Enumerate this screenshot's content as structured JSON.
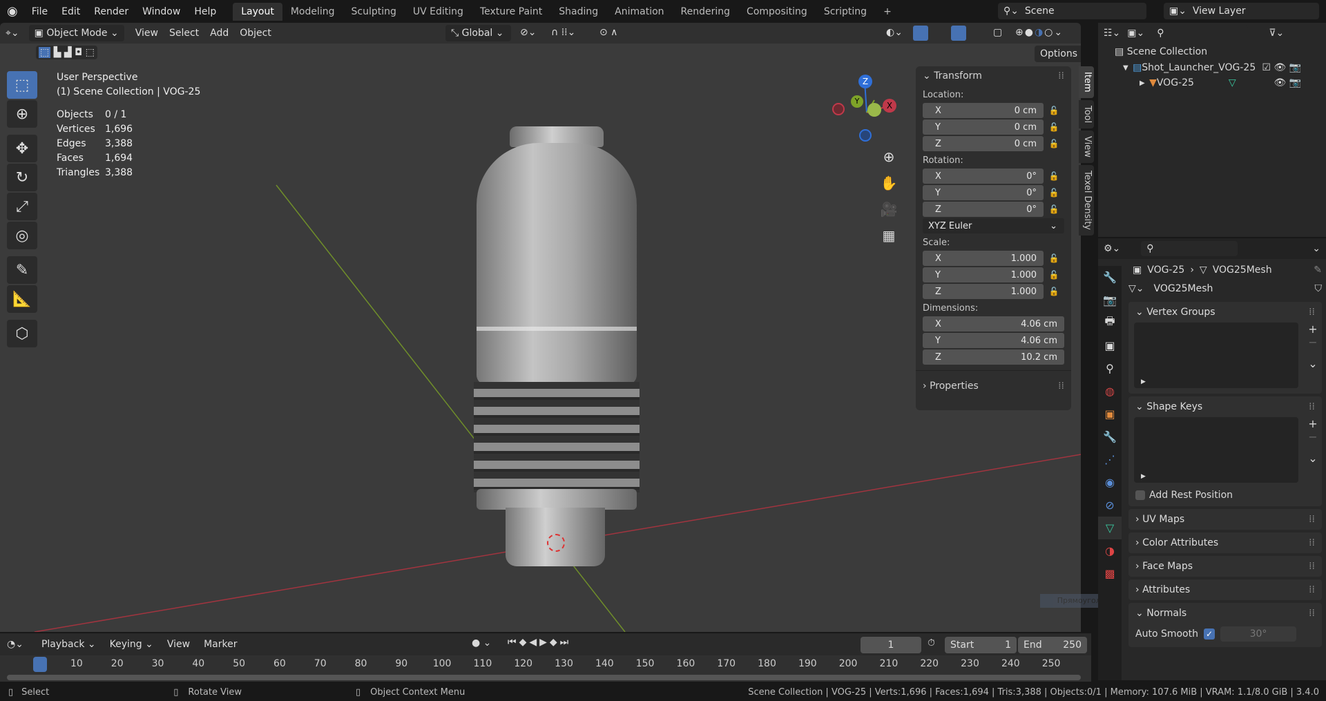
{
  "menu": [
    "File",
    "Edit",
    "Render",
    "Window",
    "Help"
  ],
  "workspaces": [
    "Layout",
    "Modeling",
    "Sculpting",
    "UV Editing",
    "Texture Paint",
    "Shading",
    "Animation",
    "Rendering",
    "Compositing",
    "Scripting"
  ],
  "scene": "Scene",
  "view_layer": "View Layer",
  "header": {
    "mode": "Object Mode",
    "menus": [
      "View",
      "Select",
      "Add",
      "Object"
    ],
    "orientation": "Global",
    "options": "Options"
  },
  "overlay": {
    "perspective": "User Perspective",
    "collection": "(1) Scene Collection | VOG-25",
    "stats": [
      [
        "Objects",
        "0 / 1"
      ],
      [
        "Vertices",
        "1,696"
      ],
      [
        "Edges",
        "3,388"
      ],
      [
        "Faces",
        "1,694"
      ],
      [
        "Triangles",
        "3,388"
      ]
    ]
  },
  "gizmo": {
    "x": "X",
    "y": "Y",
    "z": "Z"
  },
  "npanel": {
    "title": "Transform",
    "location": "Location:",
    "rotation": "Rotation:",
    "scale": "Scale:",
    "dimensions": "Dimensions:",
    "rot_mode": "XYZ Euler",
    "properties": "Properties",
    "loc": [
      [
        "X",
        "0 cm"
      ],
      [
        "Y",
        "0 cm"
      ],
      [
        "Z",
        "0 cm"
      ]
    ],
    "rot": [
      [
        "X",
        "0°"
      ],
      [
        "Y",
        "0°"
      ],
      [
        "Z",
        "0°"
      ]
    ],
    "scl": [
      [
        "X",
        "1.000"
      ],
      [
        "Y",
        "1.000"
      ],
      [
        "Z",
        "1.000"
      ]
    ],
    "dim": [
      [
        "X",
        "4.06 cm"
      ],
      [
        "Y",
        "4.06 cm"
      ],
      [
        "Z",
        "10.2 cm"
      ]
    ]
  },
  "tabs": [
    "Item",
    "Tool",
    "View",
    "Texel Density"
  ],
  "outliner": {
    "root": "Scene Collection",
    "collection": "Shot_Launcher_VOG-25",
    "object": "VOG-25"
  },
  "props": {
    "object": "VOG-25",
    "mesh": "VOG25Mesh",
    "datablock": "VOG25Mesh",
    "vertex_groups": "Vertex Groups",
    "shape_keys": "Shape Keys",
    "add_rest": "Add Rest Position",
    "uv_maps": "UV Maps",
    "color_attributes": "Color Attributes",
    "face_maps": "Face Maps",
    "attributes": "Attributes",
    "normals": "Normals",
    "auto_smooth": "Auto Smooth",
    "angle": "30°",
    "tooltip": "Прямоугольник"
  },
  "timeline": {
    "menus": [
      "Playback",
      "Keying",
      "View",
      "Marker"
    ],
    "current": "1",
    "start_label": "Start",
    "start": "1",
    "end_label": "End",
    "end": "250",
    "ticks": [
      "1",
      "10",
      "20",
      "30",
      "40",
      "50",
      "60",
      "70",
      "80",
      "90",
      "100",
      "110",
      "120",
      "130",
      "140",
      "150",
      "160",
      "170",
      "180",
      "190",
      "200",
      "210",
      "220",
      "230",
      "240",
      "250"
    ]
  },
  "status": {
    "select": "Select",
    "rotate": "Rotate View",
    "context": "Object Context Menu",
    "info": "Scene Collection | VOG-25 | Verts:1,696 | Faces:1,694 | Tris:3,388 | Objects:0/1 | Memory: 107.6 MiB | VRAM: 1.1/8.0 GiB | 3.4.0"
  },
  "colors": {
    "accent": "#4772b3",
    "x_axis": "#c0394a",
    "y_axis": "#7ea328",
    "z_axis": "#2f6fd8"
  }
}
